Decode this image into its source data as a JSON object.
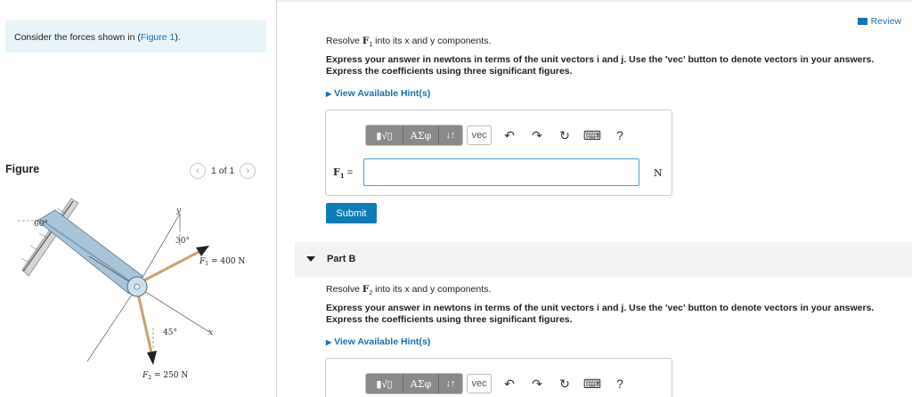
{
  "left": {
    "intro_prefix": "Consider the forces shown in (",
    "intro_link": "Figure 1",
    "intro_suffix": ").",
    "figure_title": "Figure",
    "pager_text": "1 of 1",
    "figure_labels": {
      "angle_top_left": "60°",
      "y_axis": "y",
      "angle_30": "30°",
      "f1": "F",
      "f1_sub": "1",
      "f1_value": " = 400 N",
      "x_axis": "x",
      "angle_45": "45°",
      "f2": "F",
      "f2_sub": "2",
      "f2_value": " = 250 N"
    }
  },
  "header": {
    "review_label": "Review"
  },
  "part_a": {
    "prompt_pre": "Resolve ",
    "prompt_var": "F",
    "prompt_sub": "1",
    "prompt_post": " into its x and y components.",
    "instruction_1": "Express your answer in newtons in terms of the unit vectors i and j. Use the 'vec' button to denote vectors in your answers.",
    "instruction_2": "Express the coefficients using three significant figures.",
    "hint_label": "View Available Hint(s)",
    "eq_label": "F",
    "eq_sub": "1",
    "eq_post": " =",
    "unit": "N",
    "submit_label": "Submit",
    "input_value": ""
  },
  "toolbar": {
    "btn_template": "▮√▯",
    "btn_greek": "ΑΣφ",
    "btn_arrows": "↓↑",
    "btn_vec": "vec",
    "help": "?"
  },
  "part_b": {
    "title": "Part B",
    "prompt_pre": "Resolve ",
    "prompt_var": "F",
    "prompt_sub": "2",
    "prompt_post": " into its x and y components.",
    "instruction_1": "Express your answer in newtons in terms of the unit vectors i and j. Use the 'vec' button to denote vectors in your answers.",
    "instruction_2": "Express the coefficients using three significant figures.",
    "hint_label": "View Available Hint(s)"
  },
  "colors": {
    "accent": "#1a6fb0",
    "submit": "#0d7bb5",
    "intro_bg": "#e8f4f7",
    "toolbar_btn": "#8a8a8a"
  }
}
